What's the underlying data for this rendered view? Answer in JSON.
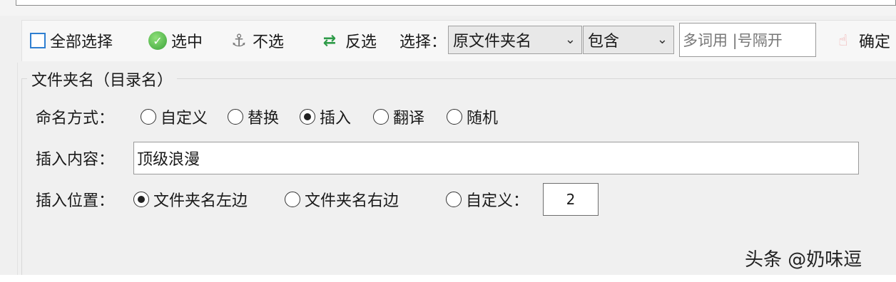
{
  "toolbar": {
    "select_all": "全部选择",
    "select": "选中",
    "deselect": "不选",
    "invert": "反选",
    "filter_label": "选择：",
    "filter_field": "原文件夹名",
    "filter_mode": "包含",
    "filter_placeholder": "多词用 |号隔开",
    "confirm": "确定",
    "icons": {
      "select": "check-circle-icon",
      "deselect": "anchor-icon",
      "invert": "shuffle-icon",
      "confirm": "pointing-hand-icon"
    }
  },
  "group": {
    "title": "文件夹名（目录名）",
    "mode_label": "命名方式：",
    "modes": [
      "自定义",
      "替换",
      "插入",
      "翻译",
      "随机"
    ],
    "selected_mode": "插入",
    "content_label": "插入内容：",
    "content_value": "顶级浪漫",
    "position_label": "插入位置：",
    "positions": [
      "文件夹名左边",
      "文件夹名右边",
      "自定义："
    ],
    "selected_position": "文件夹名左边",
    "custom_position_value": "2"
  },
  "watermark": "头条 @奶味逗",
  "colors": {
    "checkbox_border": "#2f7fd1",
    "select_icon": "#3ca33a",
    "invert_icon": "#2e9b48"
  }
}
